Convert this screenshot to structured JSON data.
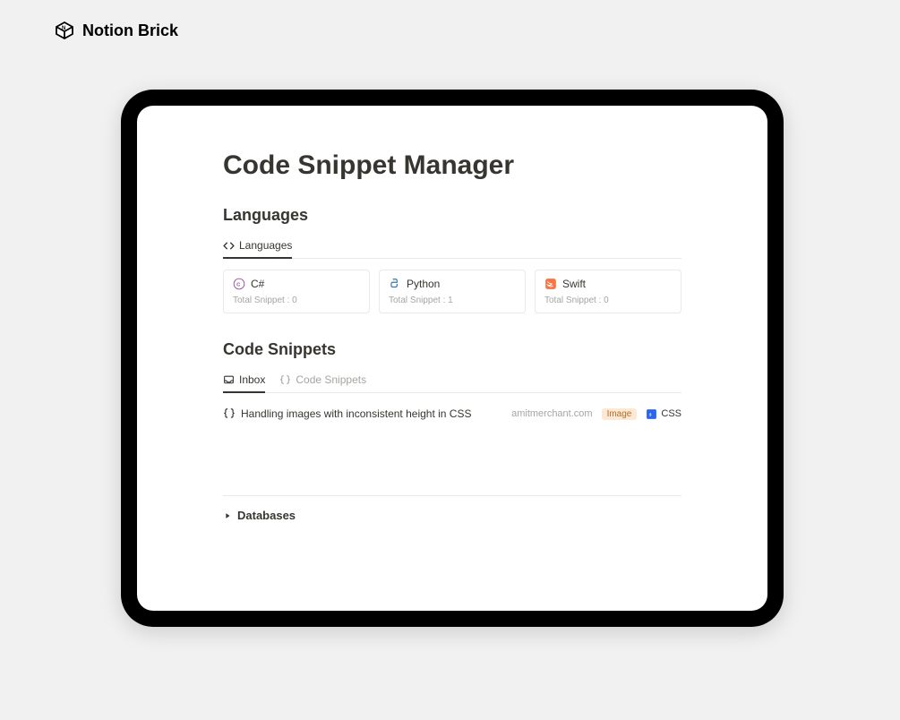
{
  "brand": {
    "name": "Notion Brick"
  },
  "page": {
    "title": "Code Snippet Manager"
  },
  "languages_section": {
    "heading": "Languages",
    "tab_label": "Languages",
    "cards": [
      {
        "name": "C#",
        "sub": "Total Snippet : 0"
      },
      {
        "name": "Python",
        "sub": "Total Snippet : 1"
      },
      {
        "name": "Swift",
        "sub": "Total Snippet : 0"
      }
    ]
  },
  "snippets_section": {
    "heading": "Code Snippets",
    "tabs": [
      {
        "label": "Inbox"
      },
      {
        "label": "Code Snippets"
      }
    ],
    "row": {
      "title": "Handling images with inconsistent height in CSS",
      "source": "amitmerchant.com",
      "tag": "Image",
      "lang": "CSS"
    }
  },
  "toggle": {
    "label": "Databases"
  }
}
